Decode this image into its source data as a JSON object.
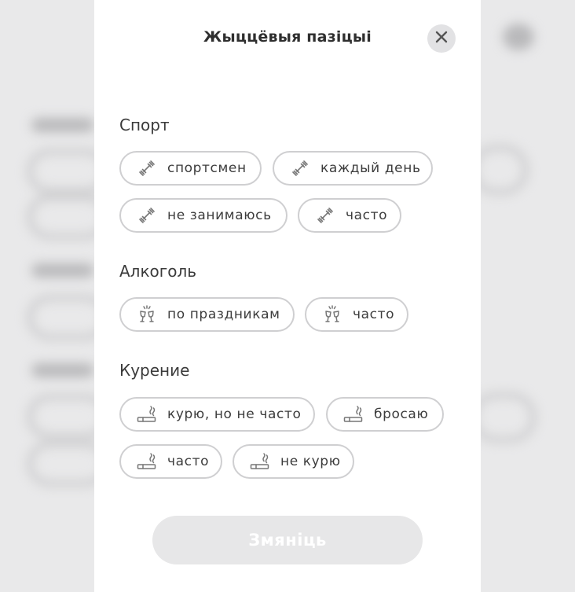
{
  "header": {
    "title": "Жыццёвыя пазіцыі",
    "close_icon": "close-icon"
  },
  "sections": {
    "sport": {
      "title": "Спорт",
      "icon": "dumbbell-icon",
      "options": [
        "спортсмен",
        "каждый день",
        "не занимаюсь",
        "часто"
      ]
    },
    "alcohol": {
      "title": "Алкоголь",
      "icon": "champagne-glasses-icon",
      "options": [
        "по праздникам",
        "часто"
      ]
    },
    "smoking": {
      "title": "Курение",
      "icon": "cigarette-icon",
      "options": [
        "курю, но не часто",
        "бросаю",
        "часто",
        "не курю"
      ]
    }
  },
  "footer": {
    "submit_label": "Змяніць"
  },
  "colors": {
    "chip_border": "#cfcfd1",
    "close_bg": "#e2e2e4",
    "submit_bg": "#e7e7e8",
    "text": "#3c3c3c"
  }
}
